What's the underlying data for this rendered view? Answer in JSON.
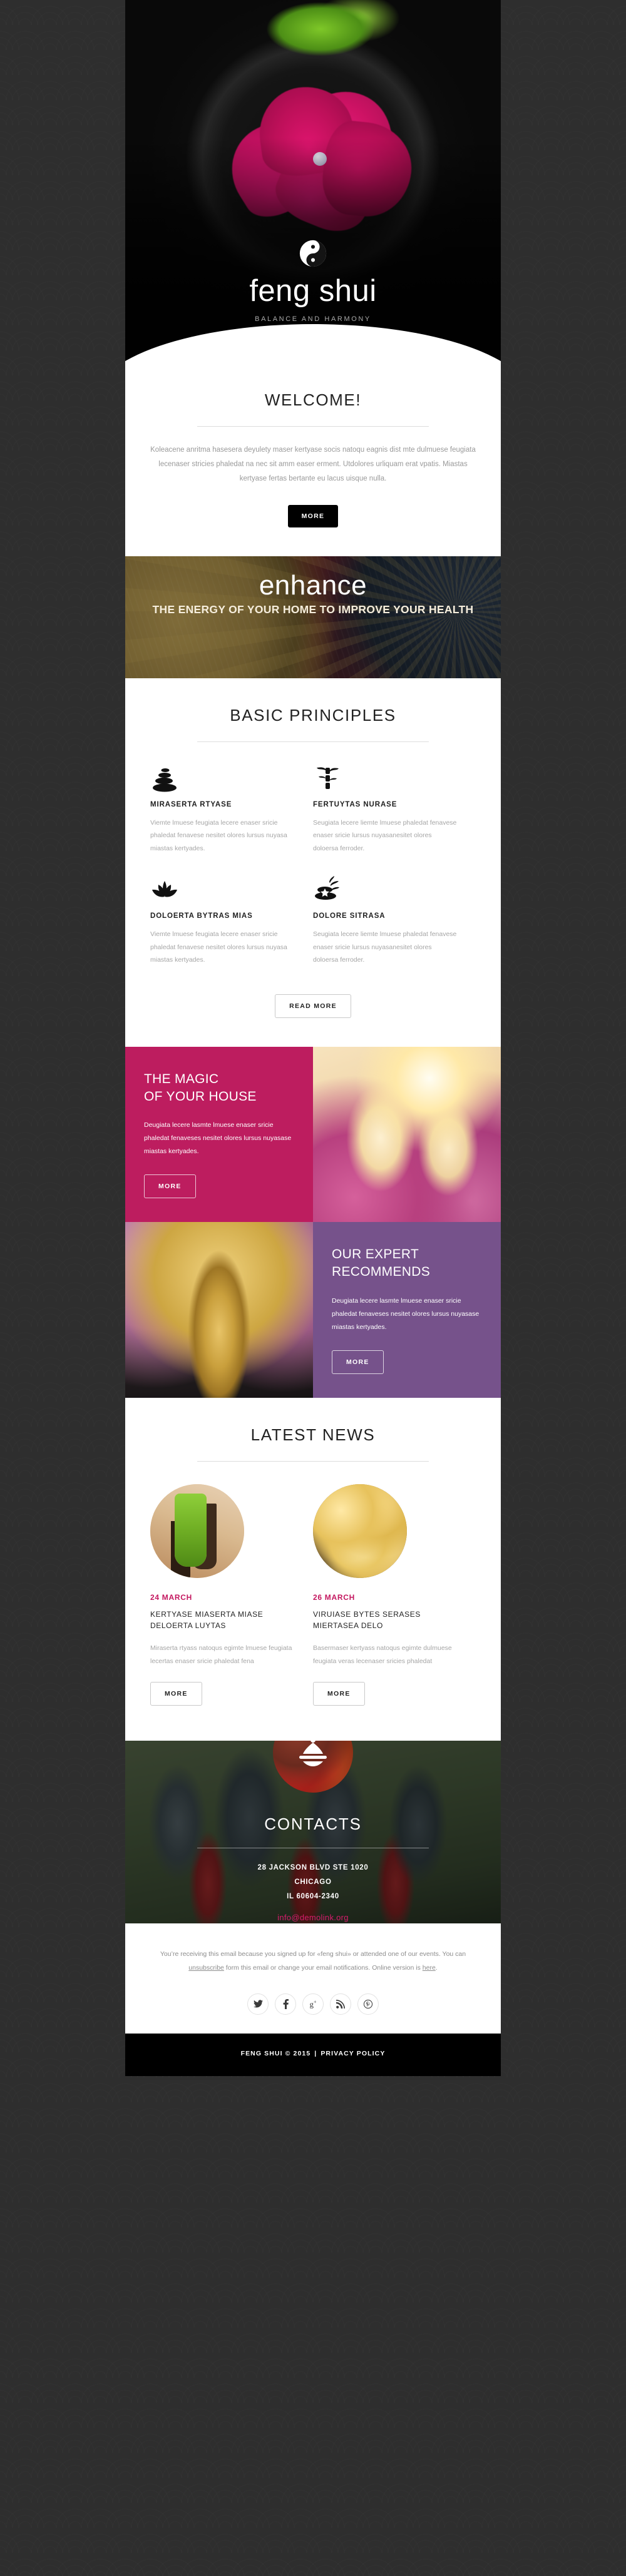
{
  "colors": {
    "accent_magenta": "#bd1d5f",
    "accent_purple": "#76528b",
    "news_date": "#c4175f",
    "email_link": "#d61c6b",
    "page_bg": "#2e2e2e",
    "dark_button": "#000000"
  },
  "hero": {
    "logo_icon": "yin-yang-icon",
    "brand": "feng shui",
    "tagline": "BALANCE AND HARMONY"
  },
  "welcome": {
    "title": "WELCOME!",
    "body": "Koleacene anritma hasesera deyulety maser kertyase socis natoqu eagnis dist mte dulmuese feugiata lecenaser stricies phaledat na nec sit amm easer erment. Utdolores urliquam erat vpatis. Miastas kertyase fertas bertante eu lacus uisque nulla.",
    "button": "MORE"
  },
  "enhance": {
    "word": "enhance",
    "subtitle": "THE ENERGY OF YOUR HOME TO IMPROVE YOUR HEALTH"
  },
  "principles": {
    "title": "BASIC PRINCIPLES",
    "items": [
      {
        "icon": "stacked-stones-icon",
        "title": "MIRASERTA RTYASE",
        "text": "Viemte lmuese feugiata lecere enaser sricie phaledat fenavese nesitet olores lursus nuyasa miastas kertyades."
      },
      {
        "icon": "bamboo-icon",
        "title": "FERTUYTAS NURASE",
        "text": "Seugiata lecere liemte lmuese phaledat fenavese enaser sricie lursus nuyasanesitet olores doloersa ferroder."
      },
      {
        "icon": "lotus-icon",
        "title": "DOLOERTA BYTRAS MIAS",
        "text": "Viemte lmuese feugiata lecere enaser sricie phaledat fenavese nesitet olores lursus nuyasa miastas kertyades."
      },
      {
        "icon": "stone-flower-icon",
        "title": "DOLORE SITRASA",
        "text": "Seugiata lecere liemte lmuese phaledat fenavese enaser sricie lursus nuyasanesitet olores doloersa ferroder."
      }
    ],
    "button": "READ MORE"
  },
  "magic": {
    "heading_line1": "THE MAGIC",
    "heading_line2": "OF YOUR HOUSE",
    "text": "Deugiata lecere lasmte lmuese enaser sricie phaledat fenaveses nesitet olores lursus nuyasase miastas kertyades.",
    "button": "MORE",
    "image": "candles-and-flowers-photo"
  },
  "expert": {
    "heading_line1": "OUR EXPERT",
    "heading_line2": "RECOMMENDS",
    "text": "Deugiata lecere lasmte lmuese enaser sricie phaledat fenaveses nesitet olores lursus nuyasase miastas kertyades.",
    "button": "MORE",
    "image": "golden-buddha-photo"
  },
  "news": {
    "title": "LATEST NEWS",
    "items": [
      {
        "thumb": "bamboo-in-vase-photo",
        "date": "24 MARCH",
        "headline": "KERTYASE MIASERTA MIASE DELOERTA LUYTAS",
        "text": "Miraserta rtyass natoqus egimte lmuese feugiata lecertas enaser sricie phaledat fena",
        "button": "MORE"
      },
      {
        "thumb": "gold-coins-photo",
        "date": "26 MARCH",
        "headline": "VIRUIASE BYTES SERASES MIERTASEA DELO",
        "text": "Basermaser kertyass natoqus egimte dulmuese feugiata veras lecenaser sricies phaledat",
        "button": "MORE"
      }
    ]
  },
  "contacts": {
    "badge_icon": "pagoda-bell-icon",
    "title": "CONTACTS",
    "address_line1": "28 JACKSON BLVD STE 1020",
    "address_line2": "CHICAGO",
    "address_line3": "IL 60604-2340",
    "email": "info@demolink.org"
  },
  "footer": {
    "note_part1": "You’re receiving this email because you signed up for «feng shui» or attended one of our events. You can ",
    "unsubscribe_label": "unsubscribe",
    "note_part2": " form this email or change your email notifications. Online version is ",
    "here_label": "here",
    "note_part3": ".",
    "socials": [
      {
        "icon": "twitter-icon",
        "glyph": "🐦"
      },
      {
        "icon": "facebook-icon",
        "glyph": "f"
      },
      {
        "icon": "google-plus-icon",
        "glyph": "g⁺"
      },
      {
        "icon": "rss-icon",
        "glyph": "◔"
      },
      {
        "icon": "pinterest-icon",
        "glyph": "Ⓟ"
      }
    ],
    "copyright": "FENG SHUI © 2015",
    "separator": "|",
    "privacy_label": "PRIVACY POLICY"
  }
}
